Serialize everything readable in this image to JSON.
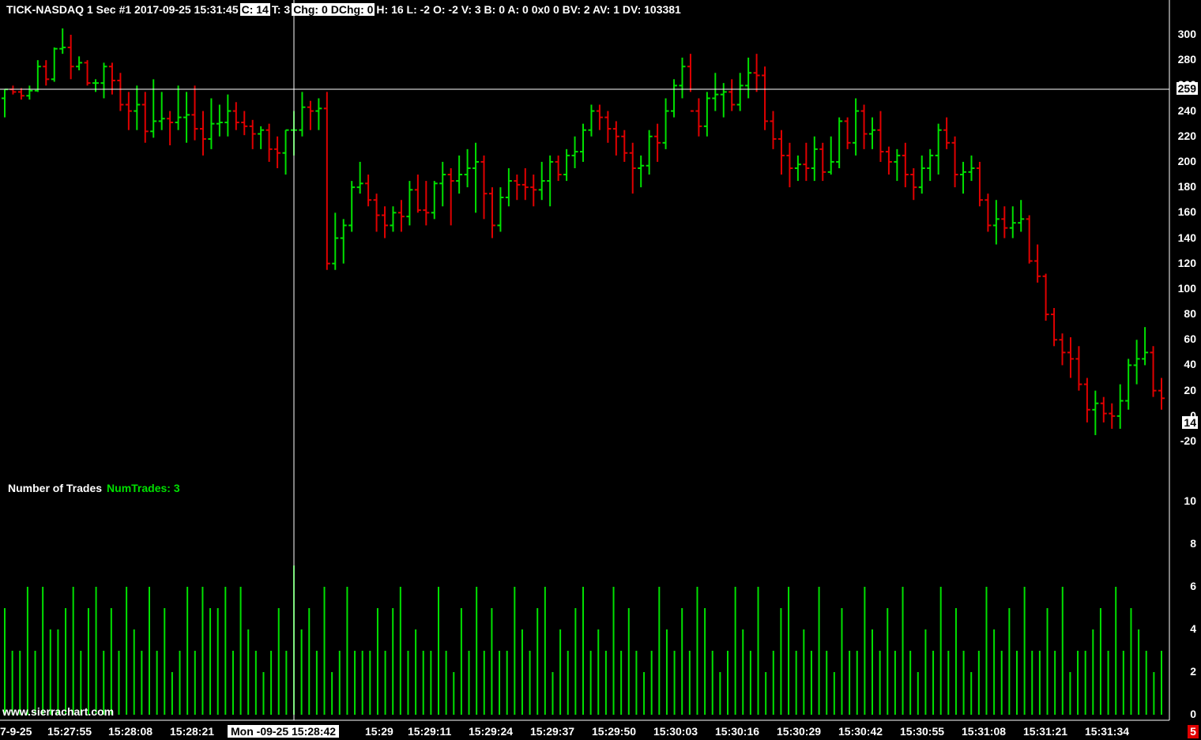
{
  "header": {
    "symbol": "TICK-NASDAQ",
    "timeframe": "1 Sec",
    "bar_info": "#1 2017-09-25 15:31:45",
    "c_label": "C: 14",
    "t_label": "T: 3",
    "chg_label": "Chg: 0",
    "dchg_label": "DChg: 0",
    "rest": "H: 16 L: -2 O: -2 V: 3 B: 0 A: 0 0x0 0 BV: 2 AV: 1 DV: 103381"
  },
  "study": {
    "name": "Number of Trades",
    "value_label": "NumTrades: 3"
  },
  "watermark": "www.sierrachart.com",
  "price_axis": {
    "ticks": [
      "300",
      "280",
      "260",
      "240",
      "220",
      "200",
      "180",
      "160",
      "140",
      "120",
      "100",
      "80",
      "60",
      "40",
      "20",
      "0",
      "-20"
    ],
    "crosshair_value": "259",
    "last_value": "14"
  },
  "volume_axis": {
    "ticks": [
      "10",
      "8",
      "6",
      "4",
      "2",
      "0"
    ]
  },
  "time_axis": {
    "first_label": "7-9-25",
    "labels": [
      "15:27:55",
      "15:28:08",
      "15:28:21",
      "Mon -09-25  15:28:42",
      "15:29",
      "15:29:11",
      "15:29:24",
      "15:29:37",
      "15:29:50",
      "15:30:03",
      "15:30:16",
      "15:30:29",
      "15:30:42",
      "15:30:55",
      "15:31:08",
      "15:31:21",
      "15:31:34"
    ]
  },
  "corner_badge": "5",
  "colors": {
    "up": "#00e000",
    "down": "#e00000",
    "background": "#000000",
    "crosshair": "#ffffff"
  },
  "chart_data": [
    {
      "type": "ohlc",
      "title": "TICK-NASDAQ 1 Sec",
      "ylim": [
        -20,
        300
      ],
      "series": [
        {
          "name": "TICK-NASDAQ",
          "bars": [
            [
              250,
              257,
              235,
              257
            ],
            [
              257,
              260,
              253,
              255
            ],
            [
              255,
              258,
              249,
              252
            ],
            [
              252,
              260,
              249,
              256
            ],
            [
              256,
              280,
              255,
              275
            ],
            [
              275,
              280,
              260,
              265
            ],
            [
              265,
              290,
              263,
              289
            ],
            [
              289,
              305,
              285,
              290
            ],
            [
              290,
              300,
              265,
              275
            ],
            [
              275,
              283,
              272,
              278
            ],
            [
              278,
              280,
              260,
              262
            ],
            [
              262,
              265,
              255,
              262
            ],
            [
              262,
              278,
              250,
              275
            ],
            [
              275,
              278,
              253,
              264
            ],
            [
              264,
              270,
              240,
              245
            ],
            [
              245,
              255,
              225,
              240
            ],
            [
              240,
              260,
              225,
              245
            ],
            [
              245,
              255,
              215,
              224
            ],
            [
              224,
              265,
              219,
              232
            ],
            [
              232,
              255,
              225,
              234
            ],
            [
              234,
              240,
              213,
              231
            ],
            [
              231,
              260,
              225,
              235
            ],
            [
              235,
              255,
              215,
              237
            ],
            [
              237,
              260,
              217,
              226
            ],
            [
              226,
              240,
              205,
              218
            ],
            [
              218,
              250,
              210,
              230
            ],
            [
              230,
              245,
              220,
              231
            ],
            [
              231,
              253,
              220,
              240
            ],
            [
              240,
              247,
              225,
              231
            ],
            [
              231,
              240,
              221,
              228
            ],
            [
              228,
              233,
              210,
              222
            ],
            [
              222,
              228,
              210,
              225
            ],
            [
              225,
              230,
              200,
              210
            ],
            [
              210,
              220,
              195,
              207
            ],
            [
              207,
              225,
              190,
              225
            ],
            [
              225,
              240,
              205,
              225
            ],
            [
              225,
              255,
              220,
              243
            ],
            [
              243,
              248,
              225,
              240
            ],
            [
              240,
              250,
              225,
              242
            ],
            [
              242,
              255,
              115,
              120
            ],
            [
              120,
              160,
              115,
              140
            ],
            [
              140,
              155,
              120,
              150
            ],
            [
              150,
              185,
              145,
              180
            ],
            [
              180,
              200,
              175,
              183
            ],
            [
              183,
              190,
              165,
              170
            ],
            [
              170,
              175,
              145,
              158
            ],
            [
              158,
              165,
              140,
              150
            ],
            [
              150,
              165,
              145,
              160
            ],
            [
              160,
              170,
              145,
              157
            ],
            [
              157,
              185,
              150,
              178
            ],
            [
              178,
              190,
              160,
              162
            ],
            [
              162,
              185,
              150,
              160
            ],
            [
              160,
              185,
              155,
              183
            ],
            [
              183,
              200,
              165,
              190
            ],
            [
              190,
              195,
              150,
              185
            ],
            [
              185,
              205,
              175,
              190
            ],
            [
              190,
              210,
              180,
              195
            ],
            [
              195,
              215,
              160,
              200
            ],
            [
              200,
              205,
              155,
              175
            ],
            [
              175,
              180,
              140,
              150
            ],
            [
              150,
              180,
              145,
              172
            ],
            [
              172,
              195,
              165,
              185
            ],
            [
              185,
              190,
              170,
              182
            ],
            [
              182,
              195,
              170,
              180
            ],
            [
              180,
              190,
              165,
              178
            ],
            [
              178,
              200,
              170,
              185
            ],
            [
              185,
              205,
              165,
              200
            ],
            [
              200,
              205,
              185,
              190
            ],
            [
              190,
              210,
              185,
              205
            ],
            [
              205,
              220,
              195,
              208
            ],
            [
              208,
              230,
              200,
              225
            ],
            [
              225,
              245,
              220,
              240
            ],
            [
              240,
              245,
              225,
              235
            ],
            [
              235,
              240,
              215,
              226
            ],
            [
              226,
              232,
              205,
              220
            ],
            [
              220,
              225,
              200,
              207
            ],
            [
              207,
              215,
              175,
              195
            ],
            [
              195,
              205,
              180,
              197
            ],
            [
              197,
              225,
              190,
              220
            ],
            [
              220,
              230,
              200,
              215
            ],
            [
              215,
              250,
              210,
              240
            ],
            [
              240,
              265,
              235,
              260
            ],
            [
              260,
              282,
              250,
              275
            ],
            [
              275,
              285,
              255,
              240
            ],
            [
              240,
              250,
              220,
              228
            ],
            [
              228,
              255,
              220,
              250
            ],
            [
              250,
              270,
              240,
              253
            ],
            [
              253,
              262,
              235,
              255
            ],
            [
              255,
              265,
              240,
              245
            ],
            [
              245,
              270,
              240,
              260
            ],
            [
              260,
              282,
              250,
              270
            ],
            [
              270,
              285,
              255,
              268
            ],
            [
              268,
              275,
              225,
              232
            ],
            [
              232,
              240,
              210,
              218
            ],
            [
              218,
              225,
              190,
              205
            ],
            [
              205,
              215,
              180,
              195
            ],
            [
              195,
              205,
              185,
              198
            ],
            [
              198,
              215,
              185,
              195
            ],
            [
              195,
              220,
              185,
              210
            ],
            [
              210,
              215,
              185,
              192
            ],
            [
              192,
              220,
              190,
              200
            ],
            [
              200,
              235,
              195,
              232
            ],
            [
              232,
              235,
              210,
              215
            ],
            [
              215,
              250,
              205,
              240
            ],
            [
              240,
              245,
              210,
              222
            ],
            [
              222,
              235,
              210,
              225
            ],
            [
              225,
              240,
              200,
              208
            ],
            [
              208,
              212,
              190,
              200
            ],
            [
              200,
              210,
              185,
              205
            ],
            [
              205,
              215,
              180,
              190
            ],
            [
              190,
              195,
              170,
              180
            ],
            [
              180,
              205,
              175,
              195
            ],
            [
              195,
              210,
              185,
              205
            ],
            [
              205,
              230,
              190,
              225
            ],
            [
              225,
              235,
              210,
              215
            ],
            [
              215,
              220,
              180,
              190
            ],
            [
              190,
              200,
              175,
              192
            ],
            [
              192,
              205,
              185,
              195
            ],
            [
              195,
              200,
              165,
              170
            ],
            [
              170,
              175,
              145,
              150
            ],
            [
              150,
              170,
              135,
              155
            ],
            [
              155,
              165,
              140,
              148
            ],
            [
              148,
              165,
              140,
              152
            ],
            [
              152,
              170,
              145,
              155
            ],
            [
              155,
              158,
              120,
              122
            ],
            [
              122,
              135,
              105,
              110
            ],
            [
              110,
              112,
              75,
              80
            ],
            [
              80,
              85,
              55,
              60
            ],
            [
              60,
              65,
              40,
              50
            ],
            [
              50,
              62,
              30,
              45
            ],
            [
              45,
              55,
              20,
              25
            ],
            [
              25,
              30,
              -5,
              5
            ],
            [
              5,
              20,
              -15,
              10
            ],
            [
              10,
              15,
              -5,
              2
            ],
            [
              2,
              10,
              -10,
              0
            ],
            [
              0,
              25,
              -10,
              12
            ],
            [
              12,
              45,
              5,
              40
            ],
            [
              40,
              60,
              25,
              45
            ],
            [
              45,
              70,
              40,
              50
            ],
            [
              50,
              55,
              15,
              20
            ],
            [
              20,
              30,
              5,
              14
            ]
          ]
        }
      ]
    },
    {
      "type": "bar",
      "title": "Number of Trades",
      "ylim": [
        0,
        10
      ],
      "series": [
        {
          "name": "NumTrades",
          "values": [
            5,
            3,
            3,
            6,
            3,
            6,
            4,
            4,
            5,
            6,
            3,
            5,
            6,
            3,
            5,
            3,
            6,
            4,
            3,
            6,
            3,
            5,
            2,
            3,
            6,
            3,
            6,
            5,
            5,
            6,
            3,
            6,
            4,
            3,
            2,
            3,
            5,
            3,
            7,
            4,
            5,
            3,
            6,
            2,
            3,
            6,
            3,
            3,
            3,
            5,
            3,
            5,
            6,
            3,
            4,
            3,
            3,
            6,
            3,
            2,
            5,
            3,
            6,
            3,
            5,
            3,
            3,
            6,
            4,
            3,
            5,
            6,
            2,
            4,
            3,
            5,
            6,
            3,
            4,
            3,
            6,
            3,
            5,
            3,
            2,
            3,
            6,
            4,
            3,
            5,
            3,
            6,
            5,
            3,
            2,
            3,
            6,
            4,
            3,
            6,
            2,
            3,
            5,
            6,
            3,
            4,
            3,
            6,
            3,
            2,
            5,
            3,
            3,
            6,
            4,
            3,
            5,
            3,
            6,
            3,
            2,
            4,
            3,
            6,
            3,
            5,
            3,
            2,
            3,
            6,
            4,
            3,
            5,
            3,
            6,
            3,
            3,
            5,
            3,
            6,
            2,
            3,
            3,
            4,
            5,
            3,
            6,
            3,
            5,
            4,
            3,
            2,
            3
          ]
        }
      ]
    }
  ]
}
